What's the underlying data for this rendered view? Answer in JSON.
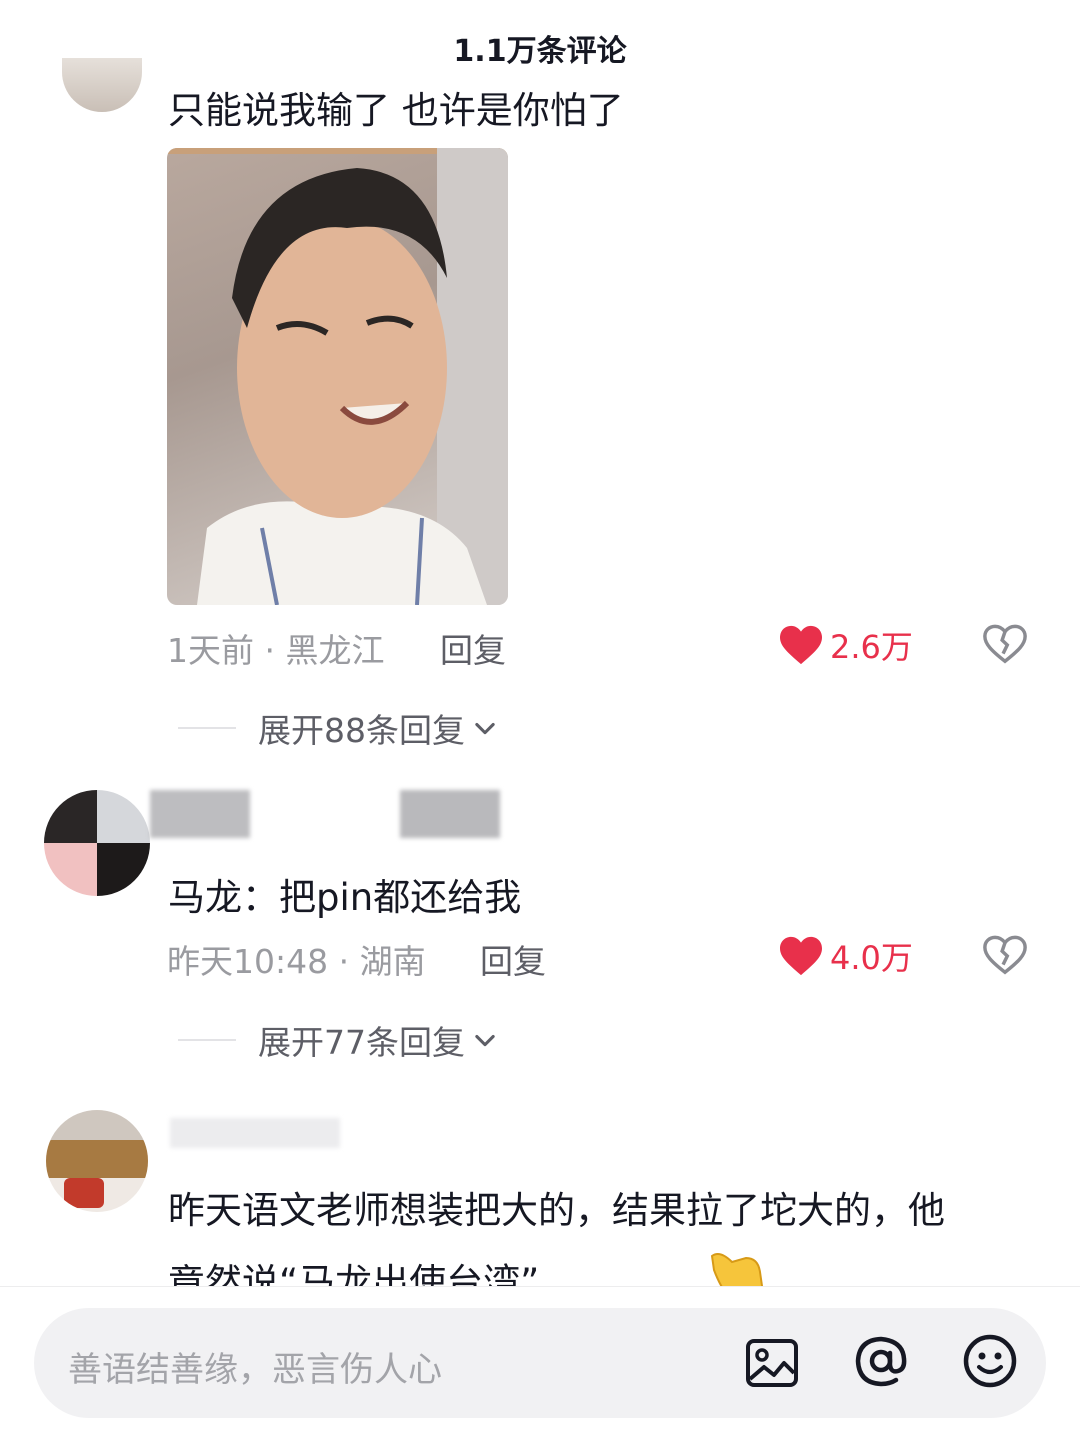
{
  "header": {
    "title": "1.1万条评论"
  },
  "comments": [
    {
      "text": "只能说我输了 也许是你怕了",
      "time": "1天前",
      "location": "黑龙江",
      "reply_label": "回复",
      "likes": "2.6万",
      "expand_label": "展开88条回复"
    },
    {
      "text": "马龙：把pin都还给我",
      "time": "昨天10:48",
      "location": "湖南",
      "reply_label": "回复",
      "likes": "4.0万",
      "expand_label": "展开77条回复"
    },
    {
      "text_line1": "昨天语文老师想装把大的，结果拉了坨大的，他",
      "text_line2": "竟然说“马龙出使台湾”。。。"
    }
  ],
  "input": {
    "placeholder": "善语结善缘，恶言伤人心"
  },
  "colors": {
    "like_red": "#e8304b",
    "meta_gray": "#9a9ba0",
    "input_bg": "#f1f1f3"
  },
  "icons": [
    "heart-icon",
    "broken-heart-icon",
    "chevron-down-icon",
    "image-icon",
    "at-icon",
    "emoji-icon"
  ]
}
